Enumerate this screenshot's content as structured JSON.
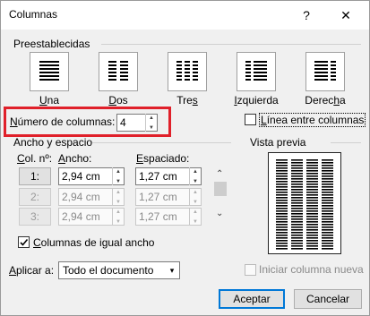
{
  "window": {
    "title": "Columnas",
    "help_glyph": "?",
    "close_glyph": "✕"
  },
  "presets": {
    "label": "Preestablecidas",
    "items": [
      {
        "label_pre": "",
        "label_u": "U",
        "label_post": "na"
      },
      {
        "label_pre": "",
        "label_u": "D",
        "label_post": "os"
      },
      {
        "label_pre": "Tre",
        "label_u": "s",
        "label_post": ""
      },
      {
        "label_pre": "",
        "label_u": "I",
        "label_post": "zquierda"
      },
      {
        "label_pre": "Derec",
        "label_u": "h",
        "label_post": "a"
      }
    ]
  },
  "num_columns": {
    "label_pre": "",
    "label_u": "N",
    "label_post": "úmero de columnas:",
    "value": "4"
  },
  "line_between": {
    "label_pre": "",
    "label_u": "L",
    "label_post": "ínea entre columnas",
    "checked": false
  },
  "width_spacing": {
    "label": "Ancho y espacio",
    "col_header_pre": "",
    "col_header_u": "C",
    "col_header_post": "ol. nº:",
    "width_header_pre": "",
    "width_header_u": "A",
    "width_header_post": "ncho:",
    "spacing_header_pre": "",
    "spacing_header_u": "E",
    "spacing_header_post": "spaciado:",
    "rows": [
      {
        "col": "1:",
        "width": "2,94 cm",
        "spacing": "1,27 cm",
        "enabled": true
      },
      {
        "col": "2:",
        "width": "2,94 cm",
        "spacing": "1,27 cm",
        "enabled": false
      },
      {
        "col": "3:",
        "width": "2,94 cm",
        "spacing": "1,27 cm",
        "enabled": false
      }
    ],
    "equal_width": {
      "label_pre": "",
      "label_u": "C",
      "label_post": "olumnas de igual ancho",
      "checked": true
    }
  },
  "preview": {
    "label": "Vista previa",
    "columns": 4
  },
  "apply_to": {
    "label_pre": "",
    "label_u": "A",
    "label_post": "plicar a:",
    "value": "Todo el documento"
  },
  "start_new_column": {
    "label": "Iniciar columna nueva",
    "checked": false
  },
  "buttons": {
    "ok": "Aceptar",
    "cancel": "Cancelar"
  },
  "colors": {
    "accent": "#0078d7",
    "highlight": "#e0202a"
  }
}
